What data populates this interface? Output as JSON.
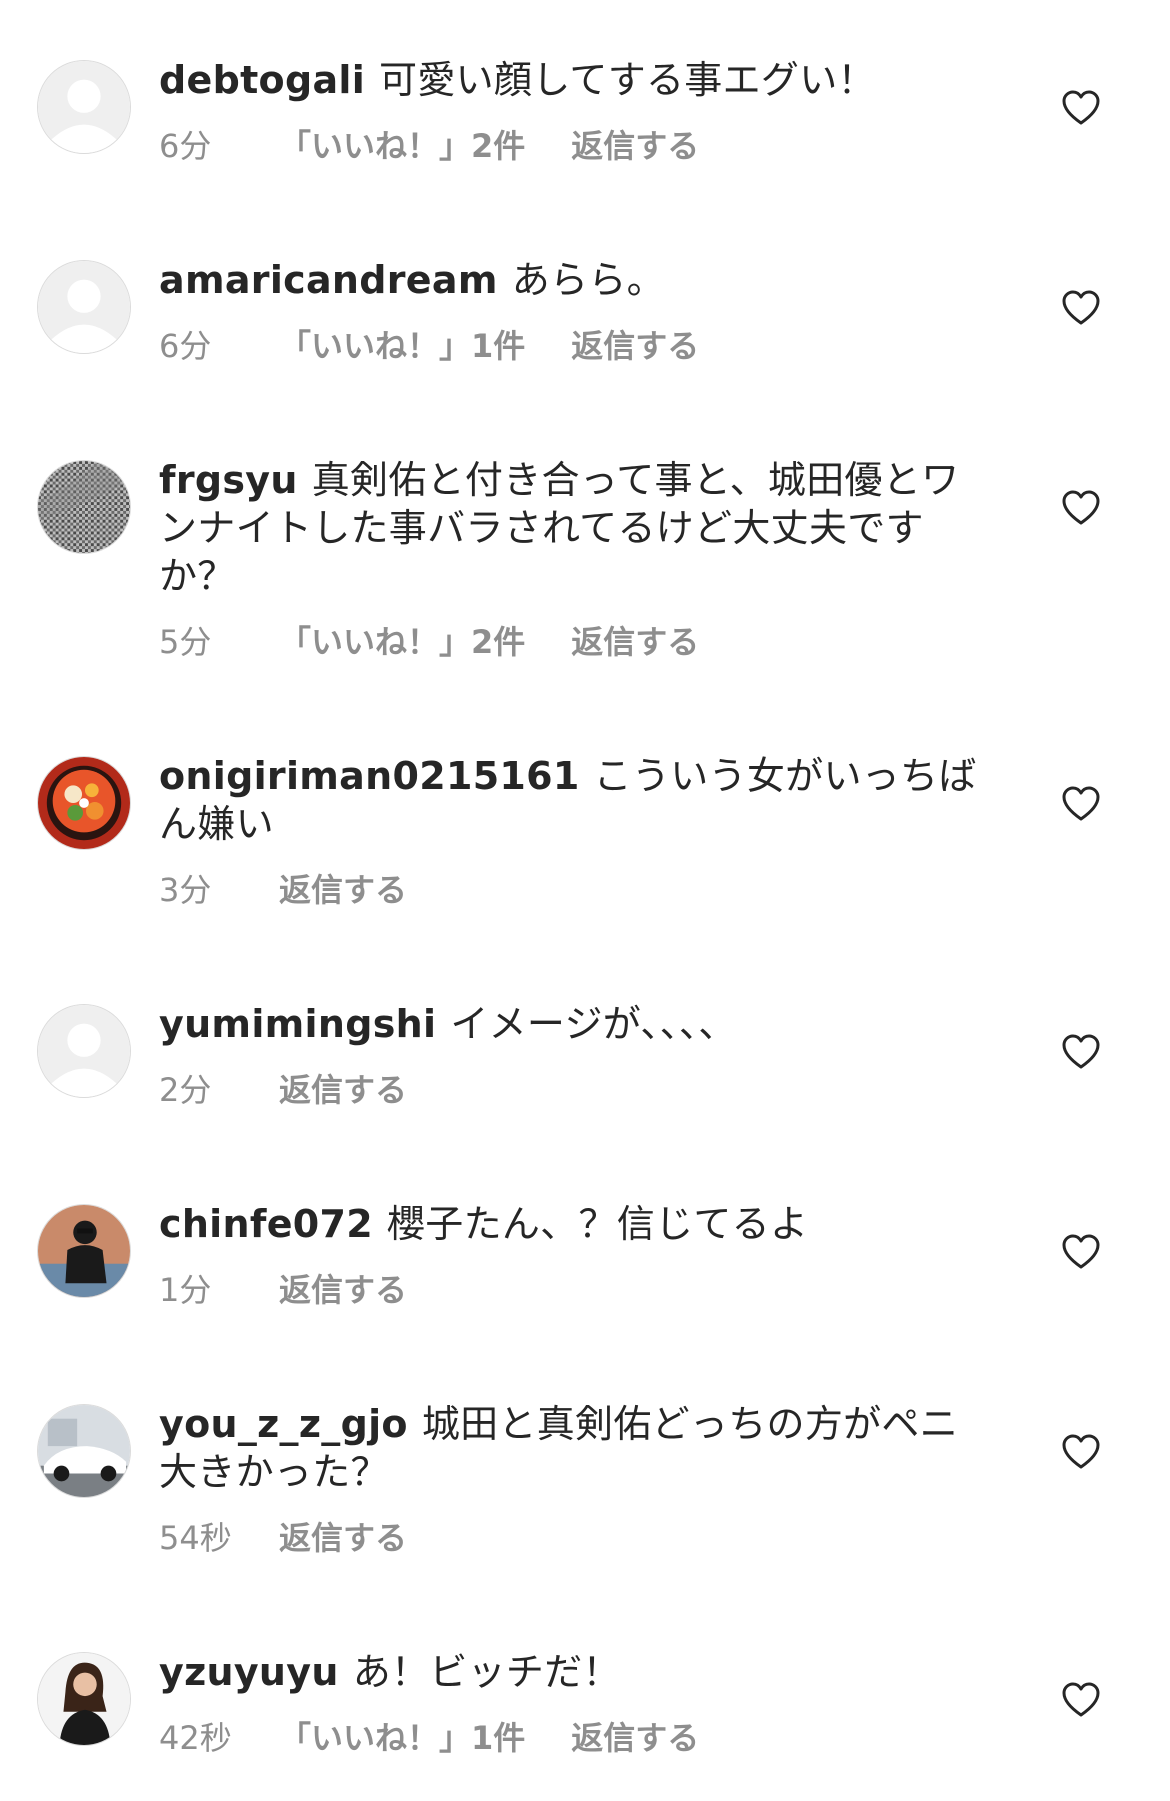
{
  "comments": [
    {
      "username": "debtogali",
      "text": "可愛い顔してする事エグい！",
      "time": "6分",
      "likes": "「いいね！」2件",
      "reply": "返信する",
      "avatar": "default-avatar-icon"
    },
    {
      "username": "amaricandream",
      "text": "あらら。",
      "time": "6分",
      "likes": "「いいね！」1件",
      "reply": "返信する",
      "avatar": "default-avatar-icon"
    },
    {
      "username": "frgsyu",
      "text": "真剣佑と付き合って事と、城田優とワンナイトした事バラされてるけど大丈夫ですか？",
      "time": "5分",
      "likes": "「いいね！」2件",
      "reply": "返信する",
      "avatar": "houndstooth-photo-avatar"
    },
    {
      "username": "onigiriman0215161",
      "text": "こういう女がいっちばん嫌い",
      "time": "3分",
      "likes": "",
      "reply": "返信する",
      "avatar": "food-bowl-photo-avatar"
    },
    {
      "username": "yumimingshi",
      "text": "イメージが、、、、",
      "time": "2分",
      "likes": "",
      "reply": "返信する",
      "avatar": "default-avatar-icon"
    },
    {
      "username": "chinfe072",
      "text": "櫻子たん、？信じてるよ",
      "time": "1分",
      "likes": "",
      "reply": "返信する",
      "avatar": "person-photo-avatar"
    },
    {
      "username": "you_z_z_gjo",
      "text": "城田と真剣佑どっちの方がペニ大きかった？",
      "time": "54秒",
      "likes": "",
      "reply": "返信する",
      "avatar": "car-photo-avatar"
    },
    {
      "username": "yzuyuyu",
      "text": "あ！ビッチだ！",
      "time": "42秒",
      "likes": "「いいね！」1件",
      "reply": "返信する",
      "avatar": "woman-photo-avatar"
    }
  ],
  "icons": {
    "like": "heart-outline-icon"
  },
  "colors": {
    "text": "#262626",
    "meta": "#8e8e8e",
    "avatar_placeholder": "#dbdbdb"
  }
}
